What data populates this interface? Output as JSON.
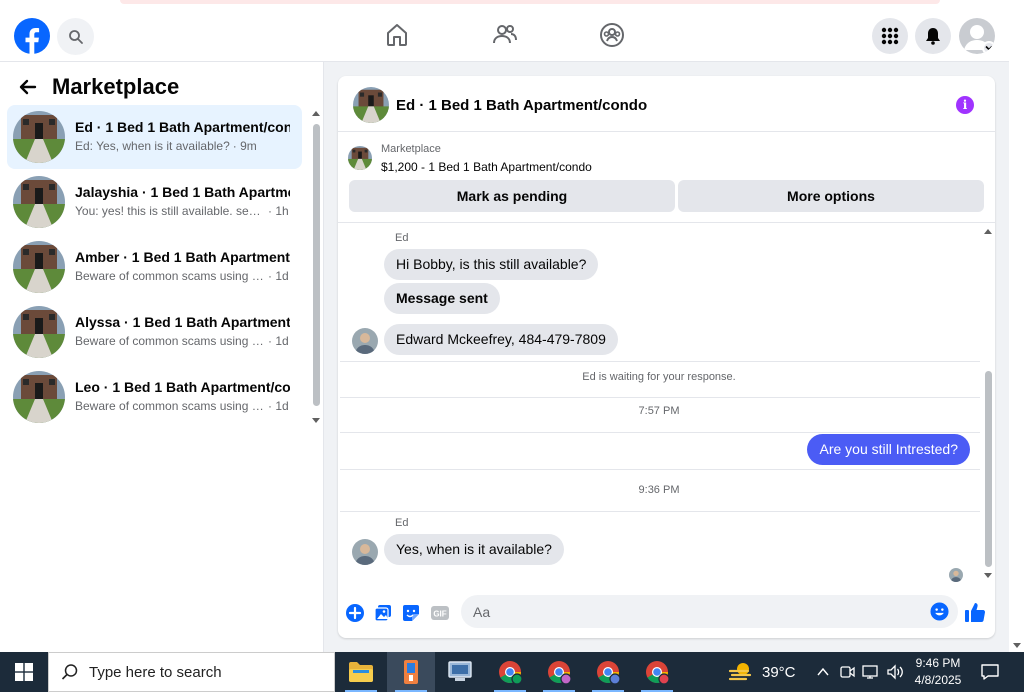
{
  "header": {
    "colors": {
      "brand": "#0866ff",
      "icon": "#65676b"
    }
  },
  "sidebar": {
    "title": "Marketplace",
    "conversations": [
      {
        "title": "Ed · 1 Bed 1 Bath Apartment/con...",
        "snippet": "Ed: Yes, when is it available?",
        "time": "· 9m",
        "active": true
      },
      {
        "title": "Jalayshia · 1 Bed 1 Bath Apartme...",
        "snippet": "You: yes! this is still available. send ...",
        "time": "· 1h"
      },
      {
        "title": "Amber · 1 Bed 1 Bath Apartment...",
        "snippet": "Beware of common scams using p...",
        "time": "· 1d"
      },
      {
        "title": "Alyssa · 1 Bed 1 Bath Apartment...",
        "snippet": "Beware of common scams using p...",
        "time": "· 1d"
      },
      {
        "title": "Leo · 1 Bed 1 Bath Apartment/co...",
        "snippet": "Beware of common scams using p...",
        "time": "· 1d"
      }
    ]
  },
  "chat": {
    "title": "Ed · 1 Bed 1 Bath Apartment/condo",
    "marketplace_label": "Marketplace",
    "listing": "$1,200 - 1 Bed 1 Bath Apartment/condo",
    "mark_pending_label": "Mark as pending",
    "more_options_label": "More options",
    "messages": {
      "sender_1": "Ed",
      "msg_1": "Hi Bobby, is this still available?",
      "msg_2": "Message sent",
      "msg_3": "Edward Mckeefrey, 484-479-7809",
      "waiting": "Ed is waiting for your response.",
      "time_1": "7:57 PM",
      "my_msg": "Are you still Intrested?",
      "time_2": "9:36 PM",
      "sender_2": "Ed",
      "msg_4": "Yes, when is it available?"
    },
    "composer_placeholder": "Aa",
    "colors": {
      "my_bubble": "#4b5cf5",
      "info": "#a033ff",
      "composer_icon": "#0866ff"
    }
  },
  "taskbar": {
    "search_placeholder": "Type here to search",
    "temperature": "39°C",
    "time": "9:46 PM",
    "date": "4/8/2025"
  }
}
